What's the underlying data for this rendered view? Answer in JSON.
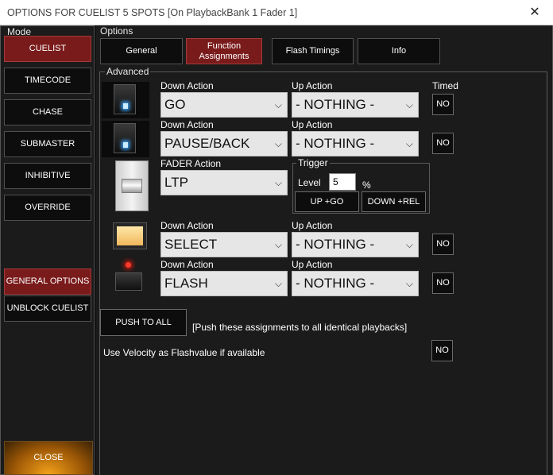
{
  "window": {
    "title": "OPTIONS FOR CUELIST 5 SPOTS  [On PlaybackBank 1 Fader 1]",
    "close_glyph": "✕"
  },
  "mode": {
    "label": "Mode",
    "buttons": [
      {
        "label": "CUELIST",
        "active": true
      },
      {
        "label": "TIMECODE",
        "active": false
      },
      {
        "label": "CHASE",
        "active": false
      },
      {
        "label": "SUBMASTER",
        "active": false
      },
      {
        "label": "INHIBITIVE",
        "active": false
      },
      {
        "label": "OVERRIDE",
        "active": false
      }
    ],
    "general_options": "GENERAL OPTIONS",
    "unblock": "UNBLOCK CUELIST",
    "close": "CLOSE"
  },
  "options": {
    "label": "Options",
    "tabs": [
      {
        "label": "General",
        "active": false
      },
      {
        "label": "Function Assignments",
        "active": true
      },
      {
        "label": "Flash Timings",
        "active": false
      },
      {
        "label": "Info",
        "active": false
      }
    ]
  },
  "advanced": {
    "label": "Advanced",
    "timed_header": "Timed",
    "rows": [
      {
        "icon": "playback-button-icon",
        "left_label": "Down Action",
        "left_value": "GO",
        "right_label": "Up Action",
        "right_value": "- NOTHING -",
        "timed": "NO"
      },
      {
        "icon": "playback-button-icon",
        "left_label": "Down Action",
        "left_value": "PAUSE/BACK",
        "right_label": "Up Action",
        "right_value": "- NOTHING -",
        "timed": "NO"
      },
      {
        "icon": "fader-icon",
        "left_label": "FADER Action",
        "left_value": "LTP"
      },
      {
        "icon": "select-button-icon",
        "left_label": "Down Action",
        "left_value": "SELECT",
        "right_label": "Up Action",
        "right_value": "- NOTHING -",
        "timed": "NO"
      },
      {
        "icon": "flash-button-icon",
        "left_label": "Down Action",
        "left_value": "FLASH",
        "right_label": "Up Action",
        "right_value": "- NOTHING -",
        "timed": "NO"
      }
    ],
    "trigger": {
      "label": "Trigger",
      "level_label": "Level",
      "level_value": "5",
      "unit": "%",
      "up_go": "UP +GO",
      "down_rel": "DOWN +REL"
    },
    "push_all": "PUSH TO ALL",
    "push_note": "[Push these assignments to all identical playbacks]",
    "velocity_label": "Use Velocity as Flashvalue if available",
    "velocity_value": "NO",
    "dropdown_glyph": "⌵"
  }
}
